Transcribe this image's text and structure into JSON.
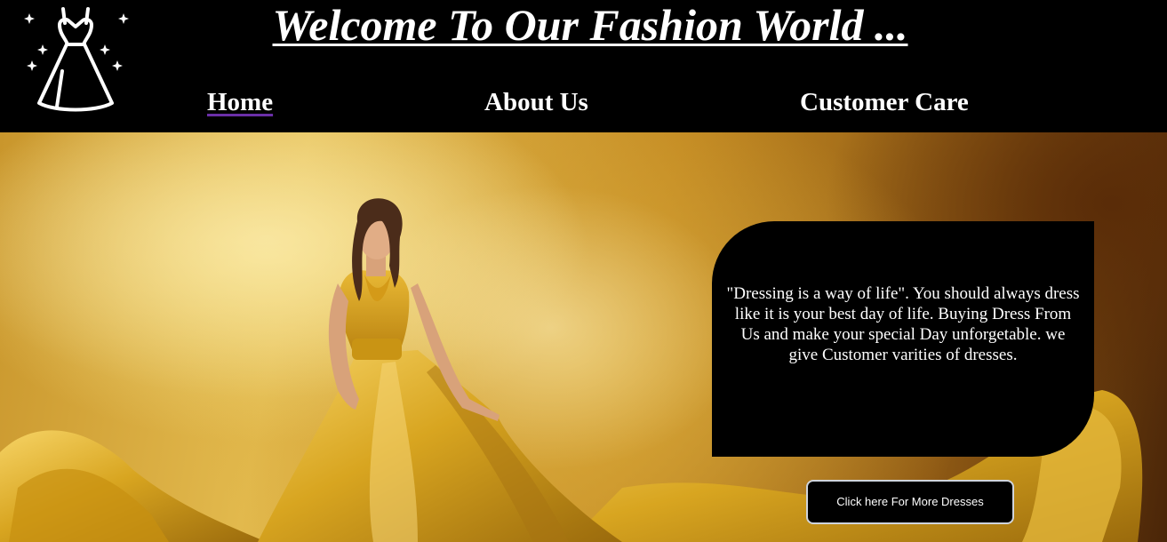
{
  "header": {
    "logo_icon": "dress-sparkle-icon",
    "title": "Welcome To Our Fashion World ...",
    "nav": {
      "home": "Home",
      "about": "About Us",
      "care": "Customer Care"
    }
  },
  "hero": {
    "image": "woman-in-golden-dress-image",
    "quote": "\"Dressing is a way of life\". You should always dress like it is your best day of life. Buying Dress From Us and make your special Day unforgetable. we give Customer varities of dresses.",
    "button_label": "Click here For More Dresses"
  },
  "colors": {
    "header_bg": "#000000",
    "text": "#ffffff",
    "active_underline": "#6b2fa8",
    "gold": "#d9a93a"
  }
}
